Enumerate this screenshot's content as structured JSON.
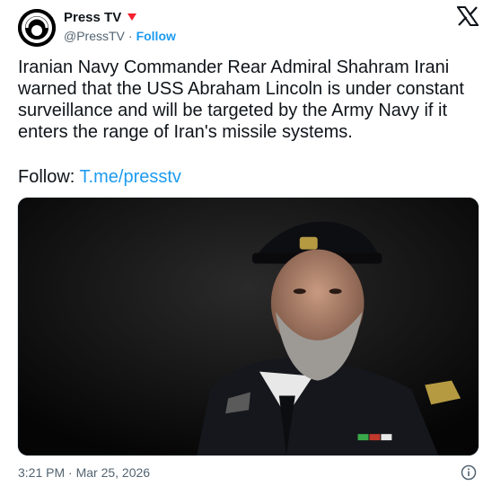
{
  "author": {
    "name": "Press TV",
    "handle": "@PressTV",
    "separator": "·",
    "follow_label": "Follow",
    "avatar_icon": "presstv-logo-avatar",
    "badge_icon": "red-triangle-badge-icon",
    "badge_color": "#f4212e"
  },
  "platform": {
    "logo_icon": "x-logo-icon"
  },
  "tweet": {
    "text": "Iranian Navy Commander Rear Admiral Shahram Irani\nwarned that the USS Abraham Lincoln is under constant\nsurveillance and will be targeted by the Army Navy if it\nenters the range of Iran's missile systems.",
    "follow_prefix": "Follow: ",
    "follow_link": "T.me/presstv"
  },
  "media": {
    "type": "photo",
    "subject": "portrait of naval officer in dark uniform"
  },
  "footer": {
    "timestamp": "3:21 PM · Mar 25, 2026",
    "info_icon": "info-circle-icon"
  },
  "colors": {
    "link": "#1d9bf0",
    "text": "#0f1419",
    "secondary": "#536471"
  }
}
